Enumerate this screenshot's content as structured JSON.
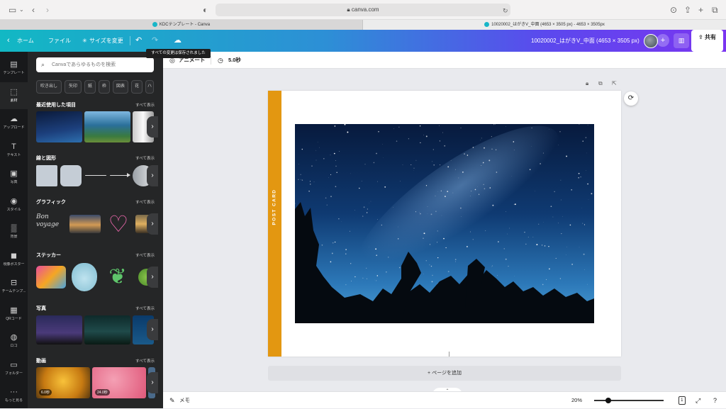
{
  "browser": {
    "url": "canva.com",
    "tabs": [
      {
        "label": "KDCテンプレート - Canva"
      },
      {
        "label": "10020002_はがきV_中面 (4653 × 3505 px) - 4653 × 3505px"
      }
    ]
  },
  "header": {
    "home_label": "ホーム",
    "file_label": "ファイル",
    "resize_label": "サイズを変更",
    "doc_title": "10020002_はがきV_中面 (4653 × 3505 px)",
    "share_label": "共有",
    "tooltip": "すべての変更は保存されました"
  },
  "rail": {
    "items": [
      {
        "label": "テンプレート",
        "icon": "template-icon"
      },
      {
        "label": "素材",
        "icon": "elements-icon"
      },
      {
        "label": "アップロード",
        "icon": "upload-icon"
      },
      {
        "label": "テキスト",
        "icon": "text-icon"
      },
      {
        "label": "写真",
        "icon": "photo-icon"
      },
      {
        "label": "スタイル",
        "icon": "style-icon"
      },
      {
        "label": "背景",
        "icon": "background-icon"
      },
      {
        "label": "現像ポスター",
        "icon": "app-icon"
      },
      {
        "label": "チームテンプ...",
        "icon": "team-template-icon"
      },
      {
        "label": "QRコード",
        "icon": "qr-code-icon"
      },
      {
        "label": "ロゴ",
        "icon": "logo-icon"
      },
      {
        "label": "フォルダー",
        "icon": "folder-icon"
      },
      {
        "label": "もっと見る",
        "icon": "more-icon"
      }
    ]
  },
  "panel": {
    "search_placeholder": "Canvaであらゆるものを検索",
    "chips": [
      "吹き出し",
      "矢印",
      "紙",
      "枠",
      "図表",
      "花",
      "ハ"
    ],
    "see_all": "すべて表示",
    "sections": [
      {
        "title": "最近使用した項目"
      },
      {
        "title": "線と図形"
      },
      {
        "title": "グラフィック"
      },
      {
        "title": "ステッカー"
      },
      {
        "title": "写真"
      },
      {
        "title": "動画"
      }
    ],
    "video_durations": [
      "6.0秒",
      "24.0秒"
    ],
    "graphic_text": "Bon voyage"
  },
  "editor": {
    "animate_label": "アニメート",
    "duration_label": "5.0秒",
    "postcard_text": "POST CARD",
    "add_page_label": "+ ページを追加",
    "notes_label": "メモ",
    "zoom_label": "20%",
    "page_count": "1",
    "zoom_fraction": 0.2
  },
  "colors": {
    "accent_stripe": "#e39711",
    "header_gradient_start": "#12b8c4",
    "header_gradient_end": "#7a35f0"
  }
}
